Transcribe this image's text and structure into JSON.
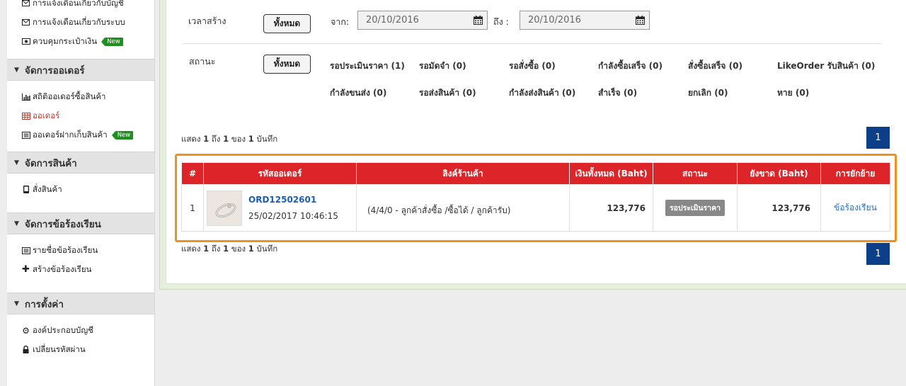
{
  "sidebar": {
    "top_items": [
      {
        "icon": "envelope-icon",
        "label": "การแจ้งเตือนเกี่ยวกับบัญชี"
      },
      {
        "icon": "envelope-icon",
        "label": "การแจ้งเตือนเกี่ยวกับระบบ"
      },
      {
        "icon": "wallet-icon",
        "label": "ควบคุมกระเป๋าเงิน",
        "badge": "New"
      }
    ],
    "sections": [
      {
        "title": "จัดการออเดอร์",
        "items": [
          {
            "icon": "bar-chart-icon",
            "label": "สถิติออเดอร์ซื้อสินค้า"
          },
          {
            "icon": "table-icon",
            "label": "ออเดอร์",
            "active": true
          },
          {
            "icon": "list-icon",
            "label": "ออเดอร์ฝากเก็บสินค้า",
            "badge": "New"
          }
        ]
      },
      {
        "title": "จัดการสินค้า",
        "items": [
          {
            "icon": "mobile-icon",
            "label": "สั่งสินค้า"
          }
        ]
      },
      {
        "title": "จัดการข้อร้องเรียน",
        "items": [
          {
            "icon": "list-icon",
            "label": "รายชื่อข้อร้องเรียน"
          },
          {
            "icon": "plus-icon",
            "label": "สร้างข้อร้องเรียน"
          }
        ]
      },
      {
        "title": "การตั้งค่า",
        "items": [
          {
            "icon": "gear-icon",
            "label": "องค์ประกอบบัญชี"
          },
          {
            "icon": "lock-icon",
            "label": "เปลี่ยนรหัสผ่าน"
          }
        ]
      }
    ]
  },
  "filters": {
    "created_label": "เวลาสร้าง",
    "all_button": "ทั้งหมด",
    "from_label": "จาก:",
    "to_label": "ถึง :",
    "date_from": "20/10/2016",
    "date_to": "20/10/2016",
    "status_label": "สถานะ",
    "status_row1": [
      "รอประเมินราคา (1)",
      "รอมัดจำ (0)",
      "รอสั่งซื้อ (0)",
      "กำลังซื้อเสร็จ (0)",
      "สั่งซื้อเสร็จ (0)",
      "LikeOrder รับสินค้า (0)"
    ],
    "status_row2": [
      "กำลังขนส่ง (0)",
      "รอส่งสินค้า (0)",
      "กำลังส่งสินค้า (0)",
      "สำเร็จ (0)",
      "ยกเลิก (0)",
      "หาย (0)"
    ]
  },
  "pagination": {
    "summary_pre": "แสดง",
    "from": "1",
    "to_word": "ถึง",
    "to": "1",
    "of_word": "ของ",
    "total": "1",
    "record_word": "บันทึก",
    "page": "1"
  },
  "table": {
    "headers": [
      "#",
      "รหัสออเดอร์",
      "ลิงค์ร้านค้า",
      "เงินทั้งหมด (Baht)",
      "สถานะ",
      "ยังขาด (Baht)",
      "การยักย้าย"
    ],
    "rows": [
      {
        "num": "1",
        "order_id": "ORD12502601",
        "datetime": "25/02/2017 10:46:15",
        "shop_link": "(4/4/0 - ลูกค้าสั่งซื้อ /ซื้อได้ / ลูกค้ารับ)",
        "total": "123,776",
        "status": "รอประเมินราคา",
        "remaining": "123,776",
        "action": "ข้อร้องเรียน"
      }
    ]
  }
}
